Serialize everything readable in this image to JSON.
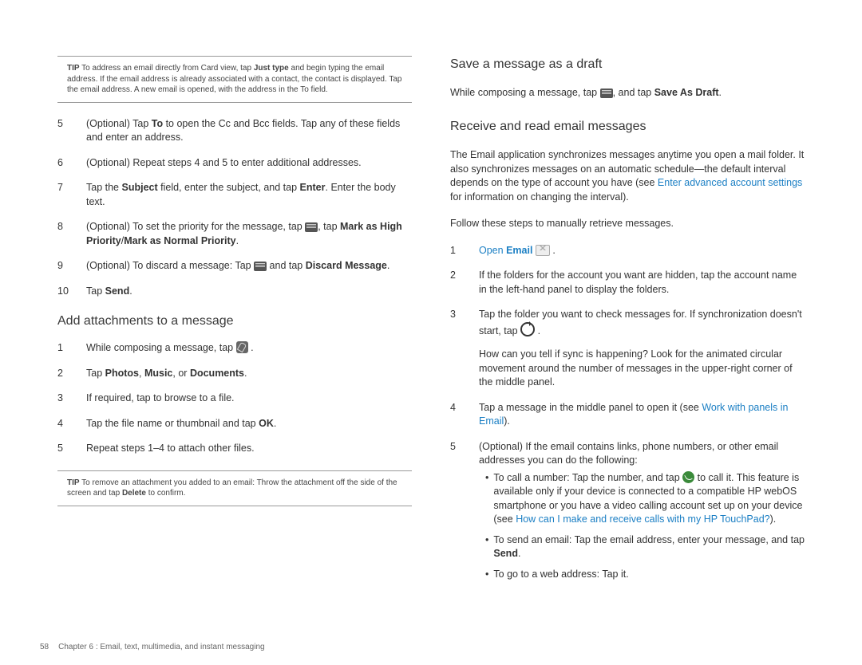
{
  "footer": {
    "page_num": "58",
    "chapter_label": "Chapter 6 : Email, text, multimedia, and instant messaging"
  },
  "left": {
    "tip1": {
      "label": "TIP",
      "pre": "To address an email directly from Card view, tap ",
      "bold1": "Just type",
      "rest": " and begin typing the email address. If the email address is already associated with a contact, the contact is displayed. Tap the email address. A new email is opened, with the address in the To field."
    },
    "steps_a": {
      "5": {
        "pre": "(Optional) Tap ",
        "b1": "To",
        "rest": " to open the Cc and Bcc fields. Tap any of these fields and enter an address."
      },
      "6": "(Optional) Repeat steps 4 and 5 to enter additional addresses.",
      "7": {
        "pre": "Tap the ",
        "b1": "Subject",
        "mid": " field, enter the subject, and tap ",
        "b2": "Enter",
        "rest": ". Enter the body text."
      },
      "8": {
        "pre": "(Optional) To set the priority for the message, tap ",
        "mid": ", tap ",
        "b1": "Mark as High Priority",
        "slash": "/",
        "b2": "Mark as Normal Priority",
        "dot": "."
      },
      "9": {
        "pre": "(Optional) To discard a message: Tap ",
        "mid": " and tap ",
        "b1": "Discard Message",
        "dot": "."
      },
      "10": {
        "pre": "Tap ",
        "b1": "Send",
        "dot": "."
      }
    },
    "subhead_attach": "Add attachments to a message",
    "steps_b": {
      "1": "While composing a message, tap ",
      "2": {
        "pre": "Tap ",
        "b1": "Photos",
        "c1": ", ",
        "b2": "Music",
        "c2": ", or ",
        "b3": "Documents",
        "dot": "."
      },
      "3": "If required, tap to browse to a file.",
      "4": {
        "pre": "Tap the file name or thumbnail and tap ",
        "b1": "OK",
        "dot": "."
      },
      "5": "Repeat steps 1–4 to attach other files."
    },
    "tip2": {
      "label": "TIP",
      "text": "To remove an attachment you added to an email: Throw the attachment off the side of the screen and tap ",
      "b1": "Delete",
      "rest": " to confirm."
    }
  },
  "right": {
    "subhead_save": "Save a message as a draft",
    "save_para": {
      "pre": "While composing a message, tap ",
      "mid": ", and tap ",
      "b1": "Save As Draft",
      "dot": "."
    },
    "subhead_recv": "Receive and read email messages",
    "recv_para1": {
      "pre": "The Email application synchronizes messages anytime you open a mail folder. It also synchronizes messages on an automatic schedule—the default interval depends on the type of account you have (see ",
      "link": "Enter advanced account settings",
      "rest": " for information on changing the interval)."
    },
    "recv_para2": "Follow these steps to manually retrieve messages.",
    "steps": {
      "1": {
        "link": "Open ",
        "bold_link": "Email",
        "dot": " ."
      },
      "2": "If the folders for the account you want are hidden, tap the account name in the left-hand panel to display the folders.",
      "3": {
        "pre": "Tap the folder you want to check messages for. If synchronization doesn't start, tap ",
        "dot": "."
      },
      "3_follow": "How can you tell if sync is happening? Look for the animated circular movement around the number of messages in the upper-right corner of the middle panel.",
      "4": {
        "pre": "Tap a message in the middle panel to open it (see ",
        "link": "Work with panels in Email",
        "rest": ")."
      },
      "5": "(Optional) If the email contains links, phone numbers, or other email addresses you can do the following:",
      "5_bullets": {
        "a": {
          "pre": "To call a number: Tap the number, and tap ",
          "mid": " to call it. This feature is available only if your device is connected to a compatible HP webOS smartphone or you have a video calling account set up on your device (see ",
          "link": "How can I make and receive calls with my HP TouchPad?",
          "rest": ")."
        },
        "b": {
          "pre": "To send an email: Tap the email address, enter your message, and tap ",
          "b1": "Send",
          "dot": "."
        },
        "c": "To go to a web address: Tap it."
      }
    }
  }
}
